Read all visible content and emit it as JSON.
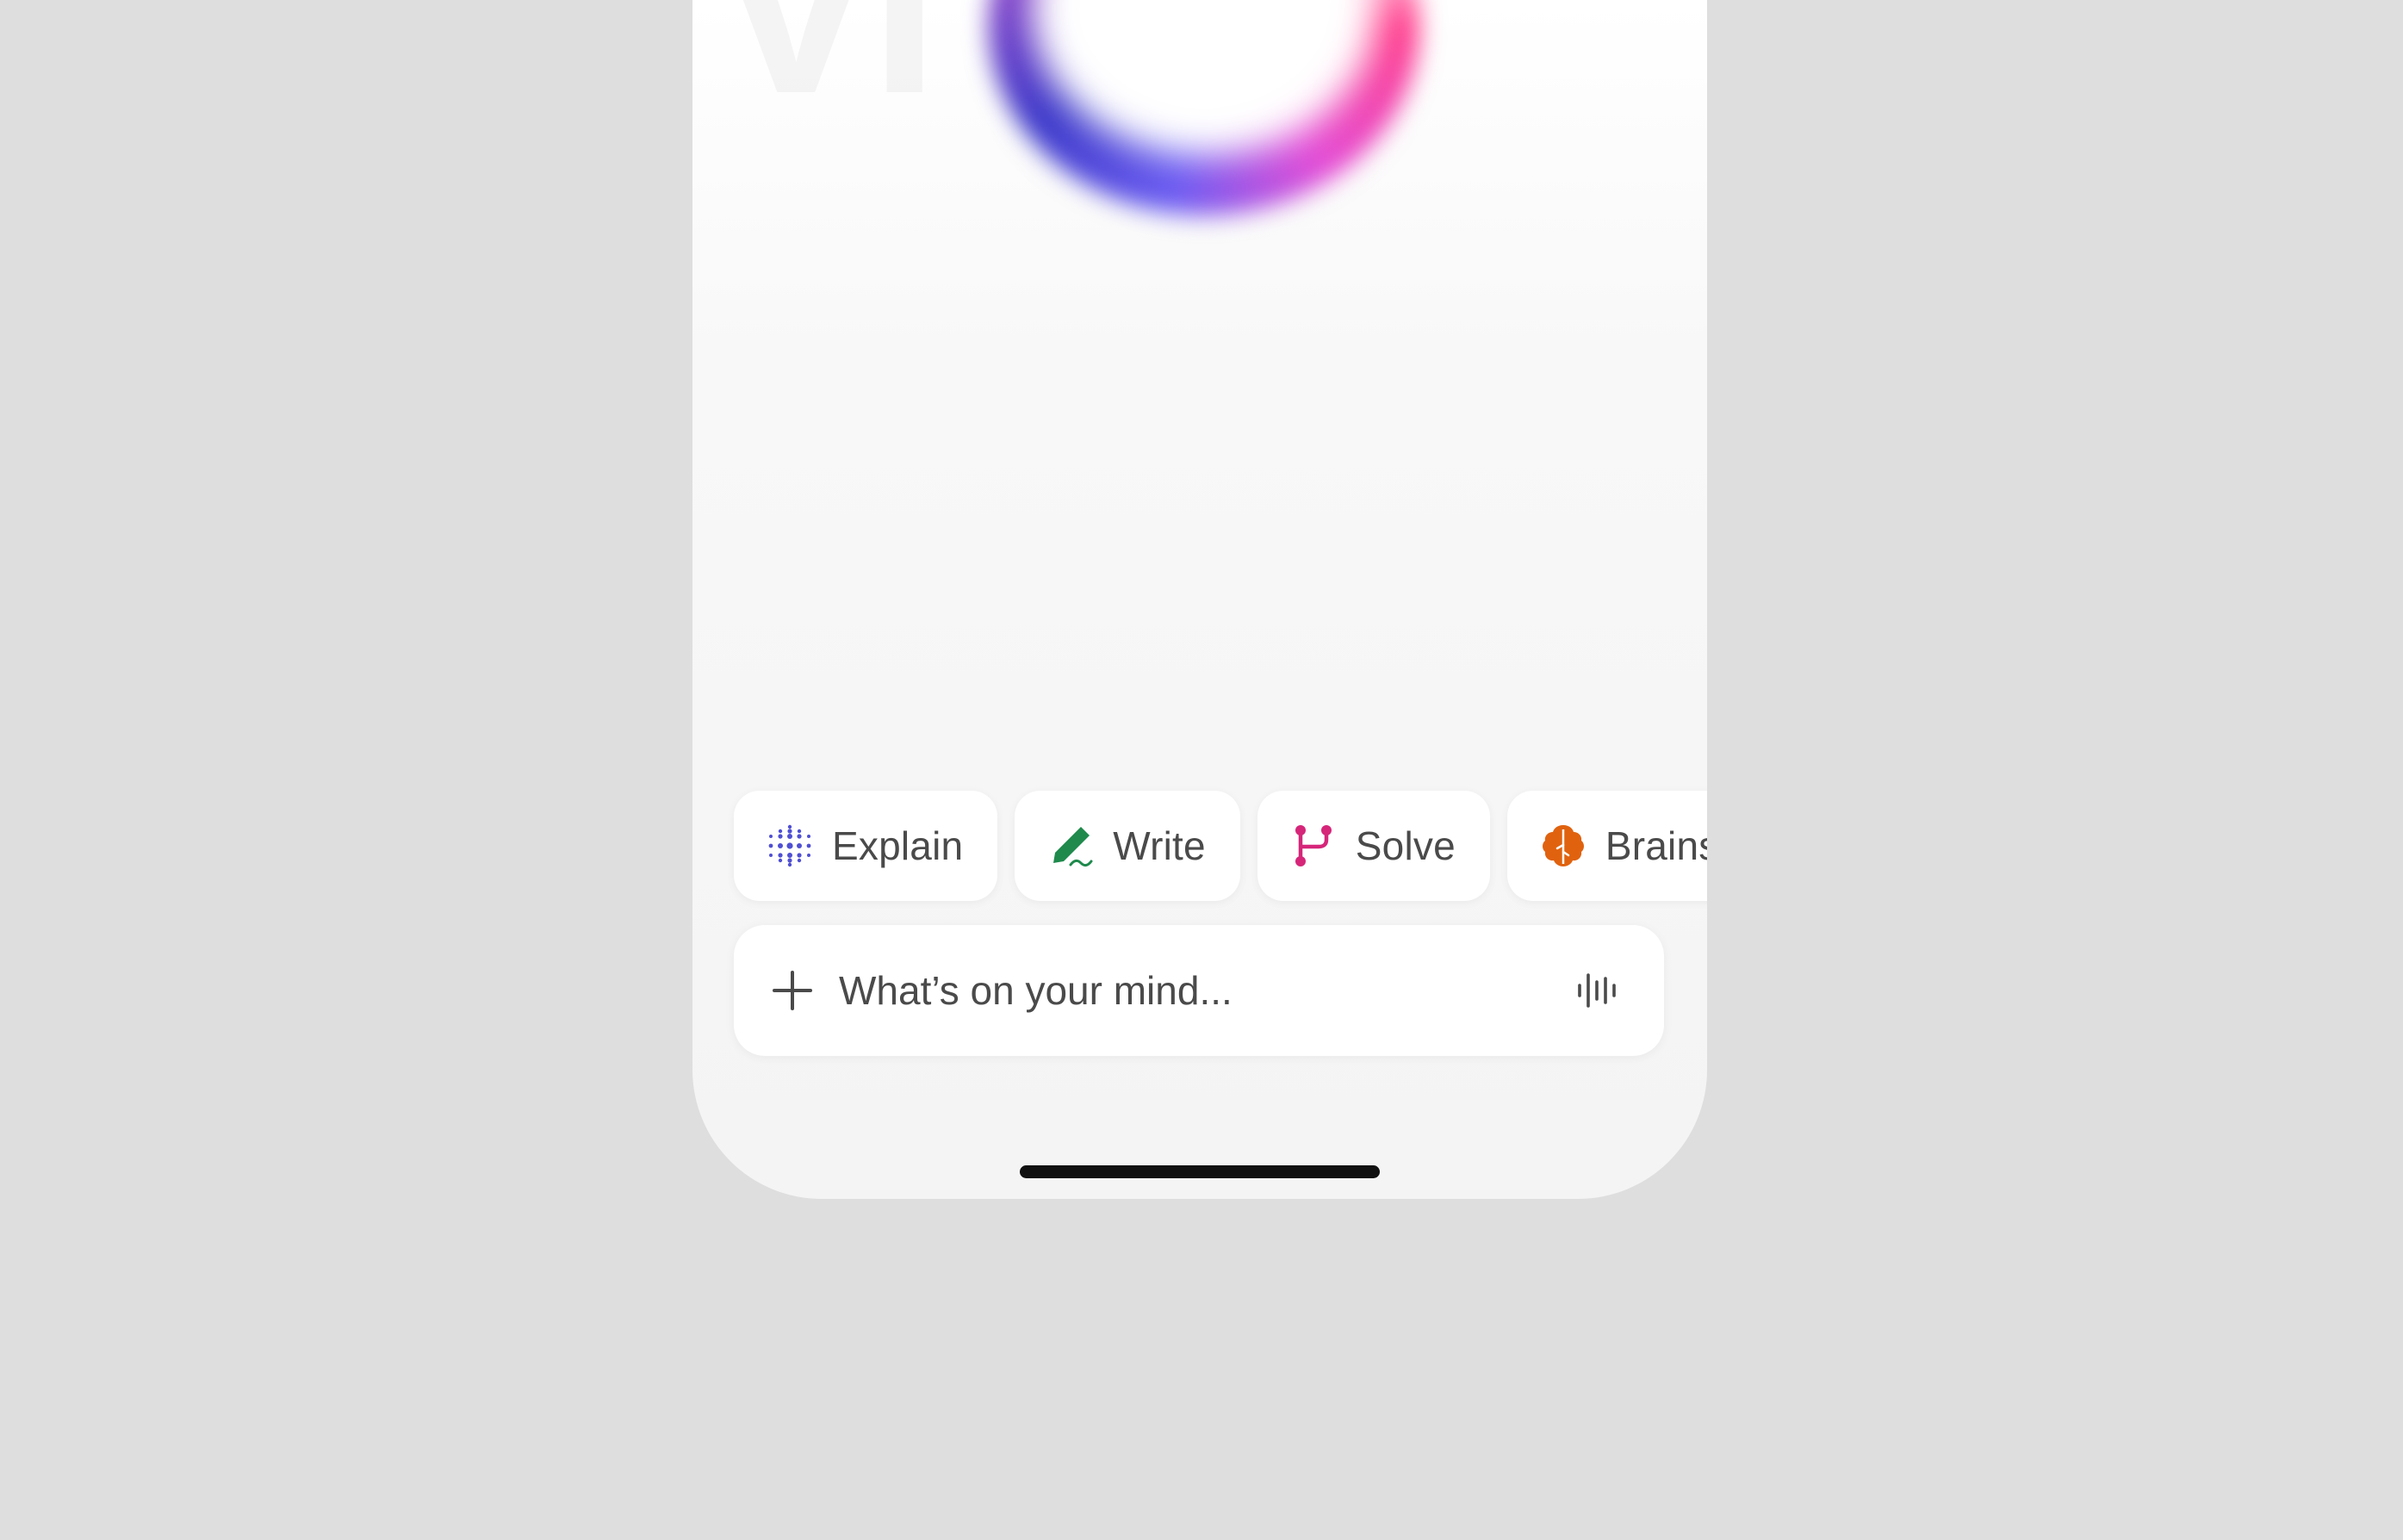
{
  "background_letters": "Vi",
  "chips": [
    {
      "label": "Explain",
      "icon": "dot-grid-icon",
      "color": "#4f4fd3"
    },
    {
      "label": "Write",
      "icon": "pen-icon",
      "color": "#1f8a4c"
    },
    {
      "label": "Solve",
      "icon": "branch-icon",
      "color": "#d6267a"
    },
    {
      "label": "Brainstorm",
      "icon": "brain-icon",
      "color": "#e0620f"
    }
  ],
  "composer": {
    "placeholder": "What’s on your mind..."
  },
  "colors": {
    "background": "#dedede",
    "surface": "#ffffff",
    "text": "#4a4a4a",
    "home_indicator": "#111111"
  }
}
